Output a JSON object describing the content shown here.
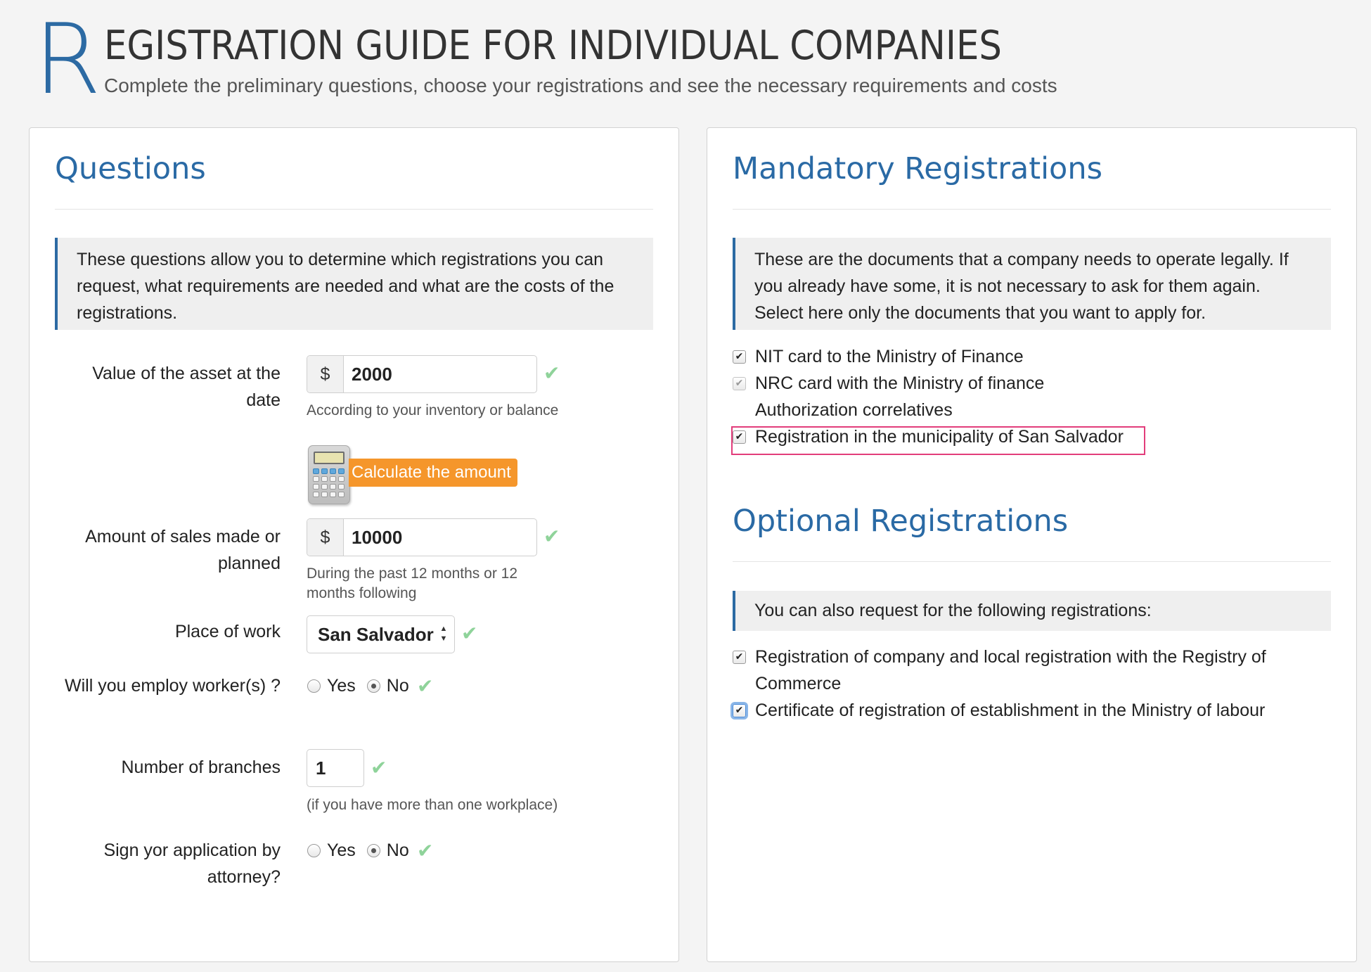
{
  "header": {
    "initial": "R",
    "title": "EGISTRATION GUIDE FOR INDIVIDUAL COMPANIES",
    "subtitle": "Complete the preliminary questions, choose your registrations and see the necessary requirements and costs"
  },
  "questions": {
    "title": "Questions",
    "intro": "These questions allow you to determine which registrations you can request, what requirements are needed and what are the costs of the registrations.",
    "asset": {
      "label": "Value of the asset at the date",
      "currency": "$",
      "value": "2000",
      "help": "According to your inventory or balance"
    },
    "calculate_button": "Calculate the amount",
    "sales": {
      "label": "Amount of sales made or planned",
      "currency": "$",
      "value": "10000",
      "help": "During the past 12 months or 12 months following"
    },
    "place": {
      "label": "Place of work",
      "selected": "San Salvador"
    },
    "employ": {
      "label": "Will you employ worker(s) ?",
      "yes": "Yes",
      "no": "No",
      "selected": "No"
    },
    "branches": {
      "label": "Number of branches",
      "value": "1",
      "help": "(if you have more than one workplace)"
    },
    "attorney": {
      "label": "Sign yor application by attorney?",
      "yes": "Yes",
      "no": "No",
      "selected": "No"
    },
    "valid_mark": "✔"
  },
  "mandatory": {
    "title": "Mandatory Registrations",
    "intro": "These are the documents that a company needs to operate legally. If you already have some, it is not necessary to ask for them again. Select here only the documents that you want to apply for.",
    "items": [
      {
        "label": "NIT card to the Ministry of Finance",
        "checked": true,
        "disabled": false
      },
      {
        "label": "NRC card with the Ministry of finance",
        "checked": true,
        "disabled": true
      },
      {
        "label": "Authorization correlatives",
        "checked": false,
        "disabled": false
      },
      {
        "label": "Registration in the municipality of San Salvador",
        "checked": true,
        "disabled": false
      }
    ]
  },
  "optional": {
    "title": "Optional Registrations",
    "intro": "You can also request for the following registrations:",
    "items": [
      {
        "label": "Registration of company and local registration with the Registry of Commerce",
        "checked": true
      },
      {
        "label": "Certificate of registration of establishment in the Ministry of labour",
        "checked": true
      }
    ]
  },
  "colors": {
    "accent": "#2c6aa3",
    "orange_button": "#f5962b",
    "valid_check": "#8fd39a",
    "highlight_box": "#e23d7b"
  },
  "icons": {
    "calculator": "calculator-icon",
    "check": "check-icon",
    "select_arrows": "select-arrows-icon"
  }
}
